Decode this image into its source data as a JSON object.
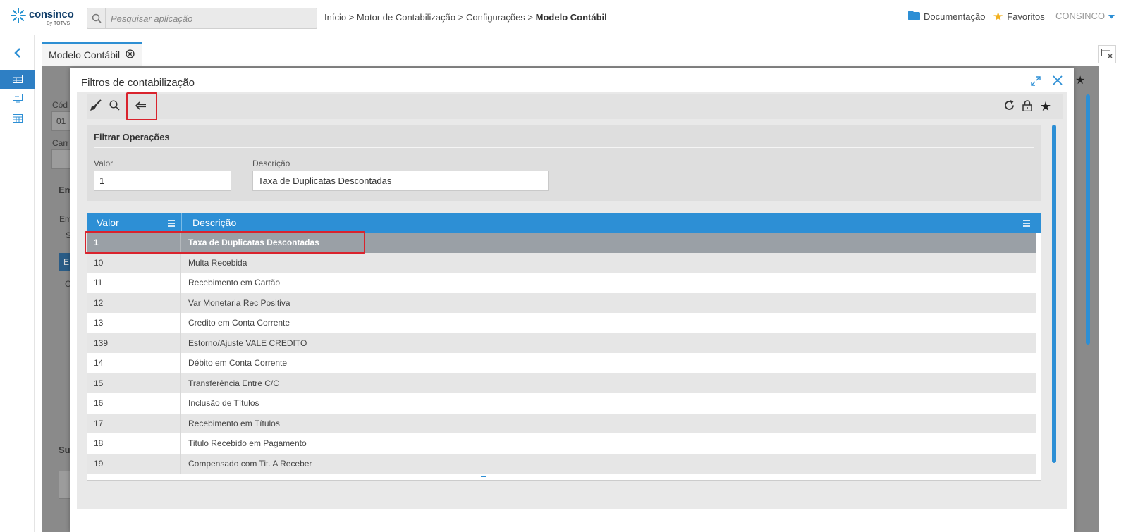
{
  "header": {
    "logo_text": "consinco",
    "logo_sub": "By TOTVS",
    "search_placeholder": "Pesquisar aplicação",
    "breadcrumb": {
      "items": [
        "Início",
        "Motor de Contabilização",
        "Configurações"
      ],
      "separator": ">",
      "current": "Modelo Contábil"
    },
    "documentation_label": "Documentação",
    "favorites_label": "Favoritos",
    "user_label": "CONSINCO"
  },
  "tabs": [
    {
      "label": "Modelo Contábil",
      "active": true
    }
  ],
  "background_page": {
    "labels": [
      "Cód",
      "01",
      "Carr",
      "Em",
      "Em",
      "S",
      "E",
      "C",
      "Su"
    ]
  },
  "modal": {
    "title": "Filtros de contabilização",
    "filter": {
      "title": "Filtrar Operações",
      "valor_label": "Valor",
      "valor_value": "1",
      "descricao_label": "Descrição",
      "descricao_value": "Taxa de Duplicatas Descontadas"
    },
    "grid": {
      "columns": [
        "Valor",
        "Descrição"
      ],
      "rows": [
        {
          "valor": "1",
          "descricao": "Taxa de Duplicatas Descontadas",
          "selected": true
        },
        {
          "valor": "10",
          "descricao": "Multa Recebida"
        },
        {
          "valor": "11",
          "descricao": "Recebimento em Cartão"
        },
        {
          "valor": "12",
          "descricao": "Var Monetaria Rec Positiva"
        },
        {
          "valor": "13",
          "descricao": "Credito em Conta Corrente"
        },
        {
          "valor": "139",
          "descricao": "Estorno/Ajuste VALE CREDITO"
        },
        {
          "valor": "14",
          "descricao": "Débito em Conta Corrente"
        },
        {
          "valor": "15",
          "descricao": "Transferência Entre C/C"
        },
        {
          "valor": "16",
          "descricao": "Inclusão de Títulos"
        },
        {
          "valor": "17",
          "descricao": "Recebimento em Títulos"
        },
        {
          "valor": "18",
          "descricao": "Titulo Recebido em Pagamento"
        },
        {
          "valor": "19",
          "descricao": "Compensado com Tit. A Receber"
        }
      ]
    }
  },
  "colors": {
    "accent": "#2d8fd5",
    "highlight": "#d9232d",
    "selected_row": "#9aa0a6",
    "star": "#f2b01e"
  },
  "icons": [
    "search-icon",
    "folder-icon",
    "star-icon",
    "chevron-down-icon",
    "chevron-left-icon",
    "close-circle-icon",
    "broom-icon",
    "back-arrow-icon",
    "refresh-icon",
    "lock-icon",
    "expand-icon",
    "close-icon",
    "menu-icon"
  ]
}
